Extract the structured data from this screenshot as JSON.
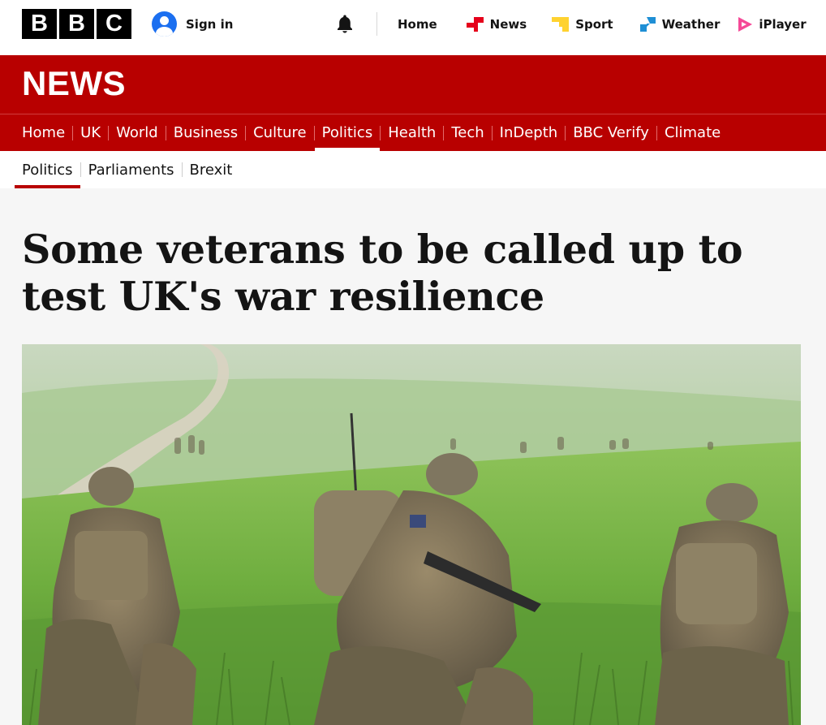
{
  "masthead": {
    "logo_letters": [
      "B",
      "B",
      "C"
    ],
    "sign_in": "Sign in",
    "nav": [
      {
        "label": "Home",
        "icon": null
      },
      {
        "label": "News",
        "icon": "news-icon",
        "color": "#e5001b"
      },
      {
        "label": "Sport",
        "icon": "sport-icon",
        "color": "#ffd230"
      },
      {
        "label": "Weather",
        "icon": "weather-icon",
        "color": "#1f8fd5"
      },
      {
        "label": "iPlayer",
        "icon": "iplayer-icon",
        "color": "#f54997"
      }
    ]
  },
  "banner": {
    "wordmark": "NEWS",
    "color": "#b80000"
  },
  "section_nav": {
    "items": [
      "Home",
      "UK",
      "World",
      "Business",
      "Culture",
      "Politics",
      "Health",
      "Tech",
      "InDepth",
      "BBC Verify",
      "Climate"
    ],
    "active": "Politics"
  },
  "sub_nav": {
    "items": [
      "Politics",
      "Parliaments",
      "Brexit"
    ],
    "active": "Politics"
  },
  "article": {
    "headline": "Some veterans to be called up to test UK's war resilience",
    "hero_image": "soldiers-in-camouflage-kneeling-in-green-field"
  }
}
